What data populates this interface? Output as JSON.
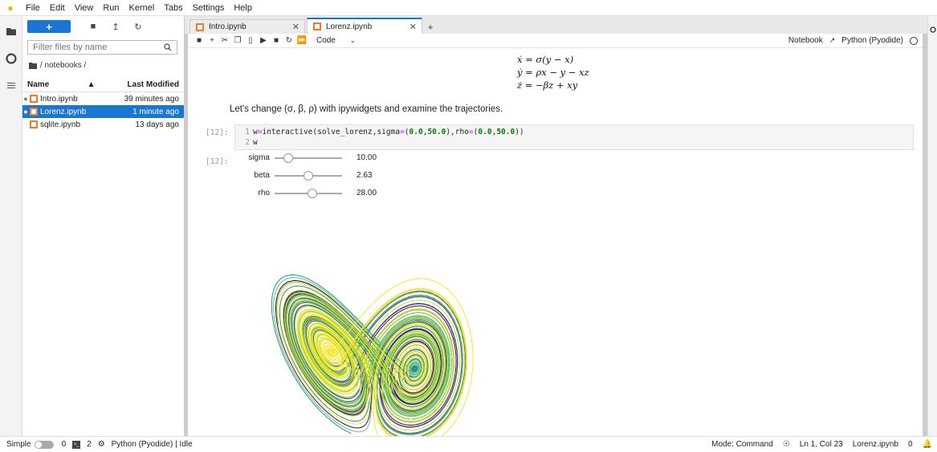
{
  "menubar": {
    "items": [
      "File",
      "Edit",
      "View",
      "Run",
      "Kernel",
      "Tabs",
      "Settings",
      "Help"
    ]
  },
  "filebrowser": {
    "new_label": "+",
    "filter_placeholder": "Filter files by name",
    "breadcrumb": "/ notebooks /",
    "col_name": "Name",
    "col_modified": "Last Modified",
    "files": [
      {
        "name": "Intro.ipynb",
        "modified": "39 minutes ago",
        "running": true,
        "selected": false
      },
      {
        "name": "Lorenz.ipynb",
        "modified": "1 minute ago",
        "running": true,
        "selected": true
      },
      {
        "name": "sqlite.ipynb",
        "modified": "13 days ago",
        "running": false,
        "selected": false
      }
    ]
  },
  "tabs": [
    {
      "label": "Intro.ipynb",
      "active": false
    },
    {
      "label": "Lorenz.ipynb",
      "active": true
    }
  ],
  "notebook_toolbar": {
    "cell_type": "Code",
    "notebook_label": "Notebook",
    "kernel_name": "Python (Pyodide)"
  },
  "notebook": {
    "equations": [
      "ẋ = σ(y − x)",
      "ẏ = ρx − y − xz",
      "ż = −βz + xy"
    ],
    "markdown": "Let's change (σ, β, ρ) with ipywidgets and examine the trajectories.",
    "code_prompt": "[12]:",
    "output_prompt": "[12]:",
    "code_lines": [
      {
        "num": "1",
        "tokens": [
          {
            "t": "w",
            "c": "k-var"
          },
          {
            "t": "=",
            "c": "k-eq"
          },
          {
            "t": "interactive(solve_lorenz,sigma",
            "c": "k-var"
          },
          {
            "t": "=",
            "c": "k-eq"
          },
          {
            "t": "(",
            "c": "k-var"
          },
          {
            "t": "0.0",
            "c": "k-num"
          },
          {
            "t": ",",
            "c": "k-var"
          },
          {
            "t": "50.0",
            "c": "k-num"
          },
          {
            "t": "),rho",
            "c": "k-var"
          },
          {
            "t": "=",
            "c": "k-eq"
          },
          {
            "t": "(",
            "c": "k-var"
          },
          {
            "t": "0.0",
            "c": "k-num"
          },
          {
            "t": ",",
            "c": "k-var"
          },
          {
            "t": "50.0",
            "c": "k-num"
          },
          {
            "t": "))",
            "c": "k-var"
          }
        ]
      },
      {
        "num": "2",
        "tokens": [
          {
            "t": "w",
            "c": "k-var"
          }
        ]
      }
    ],
    "sliders": [
      {
        "label": "sigma",
        "value": "10.00",
        "fraction": 0.2
      },
      {
        "label": "beta",
        "value": "2.63",
        "fraction": 0.5
      },
      {
        "label": "rho",
        "value": "28.00",
        "fraction": 0.56
      }
    ]
  },
  "colors": {
    "accent": "#1976d2",
    "trajectory": [
      "#440154",
      "#3b528b",
      "#21918c",
      "#5ec962",
      "#c8e020",
      "#fde725"
    ]
  },
  "statusbar": {
    "mode_label": "Simple",
    "terminals_count": "0",
    "kernels_count": "2",
    "kernel_status": "Python (Pyodide) | Idle",
    "mode": "Mode: Command",
    "cursor": "Ln 1, Col 23",
    "file": "Lorenz.ipynb",
    "notifications": "0"
  }
}
